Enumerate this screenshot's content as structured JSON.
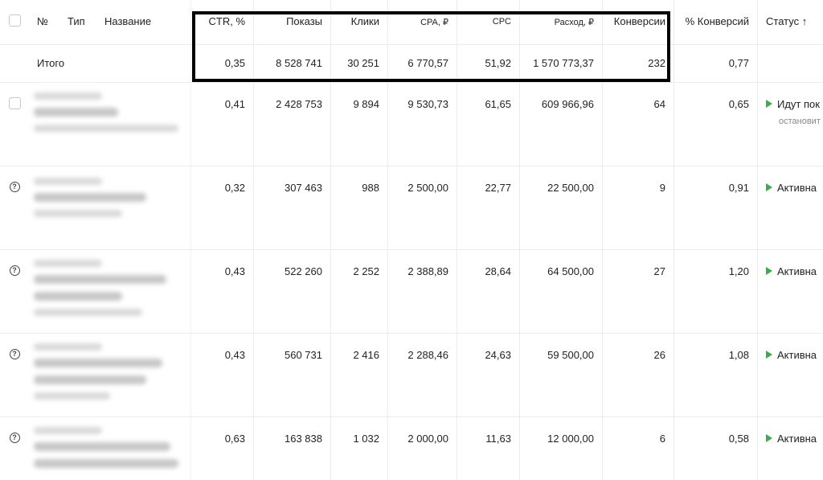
{
  "header": {
    "no": "№",
    "type": "Тип",
    "name": "Название",
    "ctr": "CTR, %",
    "impressions": "Показы",
    "clicks": "Клики",
    "cpa": "CPA, ₽",
    "cpc": "CPC",
    "spend": "Расход, ₽",
    "conversions": "Конверсии",
    "conv_rate": "% Конверсий",
    "status": "Статус ↑"
  },
  "total": {
    "label": "Итого",
    "ctr": "0,35",
    "impressions": "8 528 741",
    "clicks": "30 251",
    "cpa": "6 770,57",
    "cpc": "51,92",
    "spend": "1 570 773,37",
    "conversions": "232",
    "conv_rate": "0,77"
  },
  "rows": [
    {
      "ctr": "0,41",
      "impressions": "2 428 753",
      "clicks": "9 894",
      "cpa": "9 530,73",
      "cpc": "61,65",
      "spend": "609 966,96",
      "conversions": "64",
      "conv_rate": "0,65",
      "status": "Идут пок",
      "status_sub": "остановит"
    },
    {
      "ctr": "0,32",
      "impressions": "307 463",
      "clicks": "988",
      "cpa": "2 500,00",
      "cpc": "22,77",
      "spend": "22 500,00",
      "conversions": "9",
      "conv_rate": "0,91",
      "status": "Активна"
    },
    {
      "ctr": "0,43",
      "impressions": "522 260",
      "clicks": "2 252",
      "cpa": "2 388,89",
      "cpc": "28,64",
      "spend": "64 500,00",
      "conversions": "27",
      "conv_rate": "1,20",
      "status": "Активна"
    },
    {
      "ctr": "0,43",
      "impressions": "560 731",
      "clicks": "2 416",
      "cpa": "2 288,46",
      "cpc": "24,63",
      "spend": "59 500,00",
      "conversions": "26",
      "conv_rate": "1,08",
      "status": "Активна"
    },
    {
      "ctr": "0,63",
      "impressions": "163 838",
      "clicks": "1 032",
      "cpa": "2 000,00",
      "cpc": "11,63",
      "spend": "12 000,00",
      "conversions": "6",
      "conv_rate": "0,58",
      "status": "Активна"
    }
  ],
  "colors": {
    "status_active": "#35b042",
    "highlight_border": "#000000"
  }
}
